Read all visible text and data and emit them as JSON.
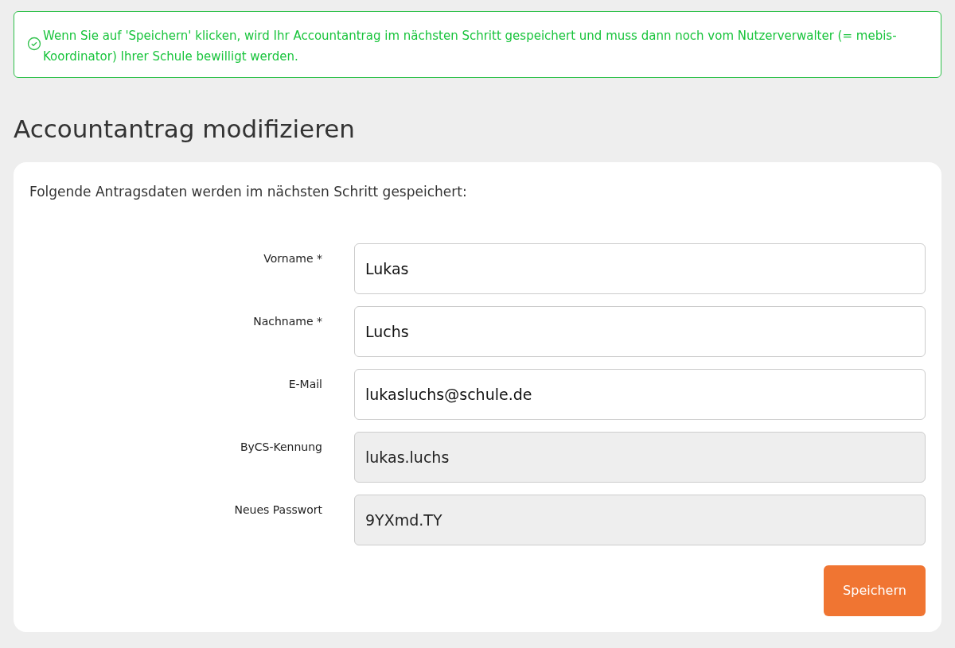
{
  "notice": {
    "text": "Wenn Sie auf 'Speichern' klicken, wird Ihr Accountantrag im nächsten Schritt gespeichert und muss dann noch vom Nutzerverwalter (= mebis-Koordinator) Ihrer Schule bewilligt werden."
  },
  "heading": "Accountantrag modifizieren",
  "form": {
    "intro": "Folgende Antragsdaten werden im nächsten Schritt gespeichert:",
    "fields": [
      {
        "label": "Vorname *",
        "value": "Lukas",
        "readonly": false
      },
      {
        "label": "Nachname *",
        "value": "Luchs",
        "readonly": false
      },
      {
        "label": "E-Mail",
        "value": "lukasluchs@schule.de",
        "readonly": false
      },
      {
        "label": "ByCS-Kennung",
        "value": "lukas.luchs",
        "readonly": true
      },
      {
        "label": "Neues Passwort",
        "value": "9YXmd.TY",
        "readonly": true
      }
    ],
    "submit": "Speichern"
  }
}
